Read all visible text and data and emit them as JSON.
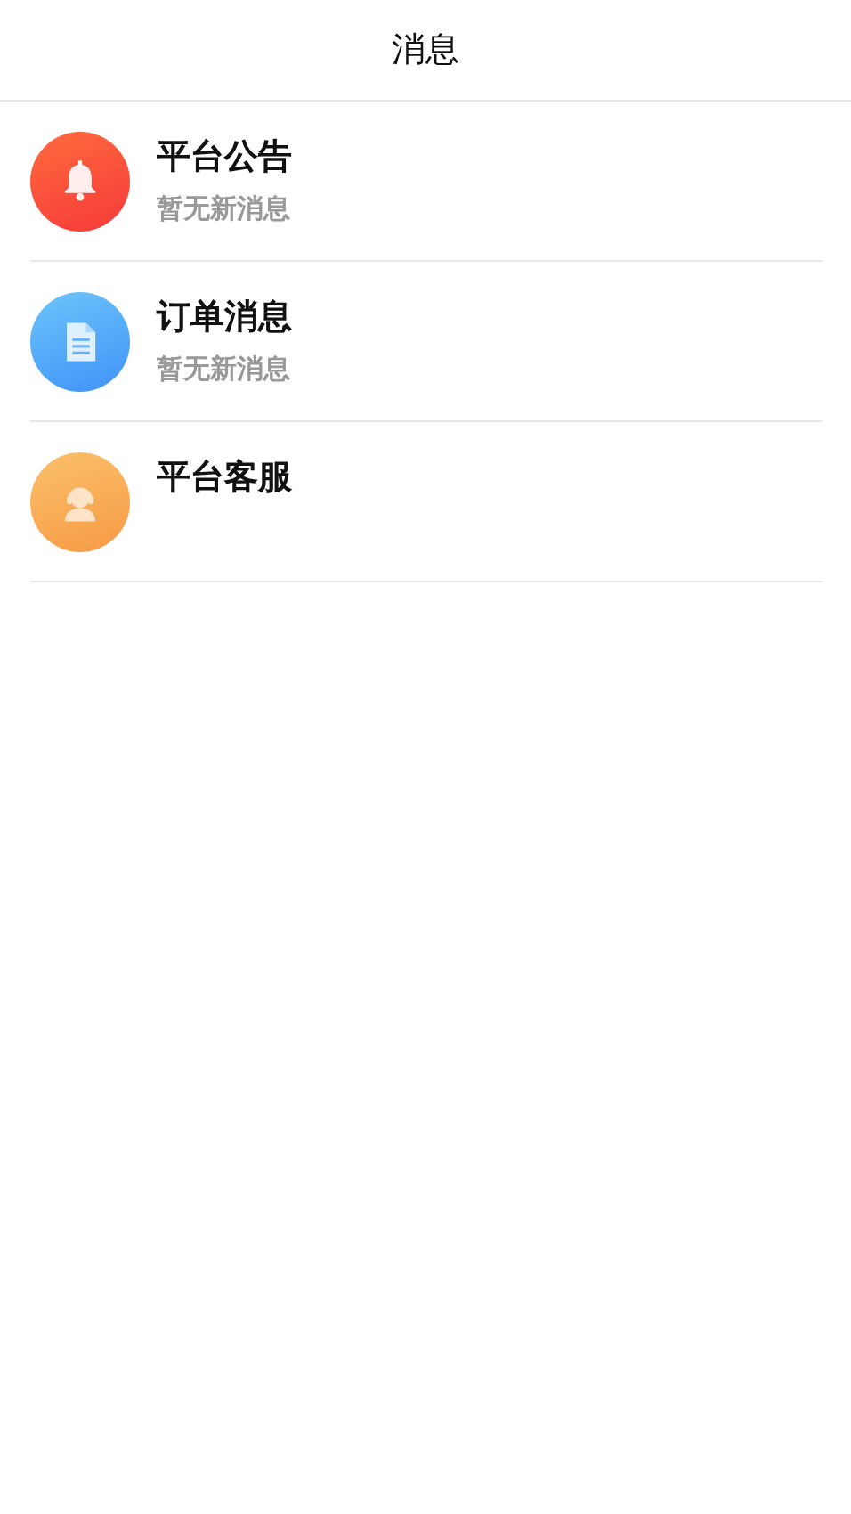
{
  "header": {
    "title": "消息"
  },
  "items": [
    {
      "kind": "bell",
      "title": "平台公告",
      "subtitle": "暂无新消息"
    },
    {
      "kind": "document",
      "title": "订单消息",
      "subtitle": "暂无新消息"
    },
    {
      "kind": "headset",
      "title": "平台客服"
    }
  ]
}
